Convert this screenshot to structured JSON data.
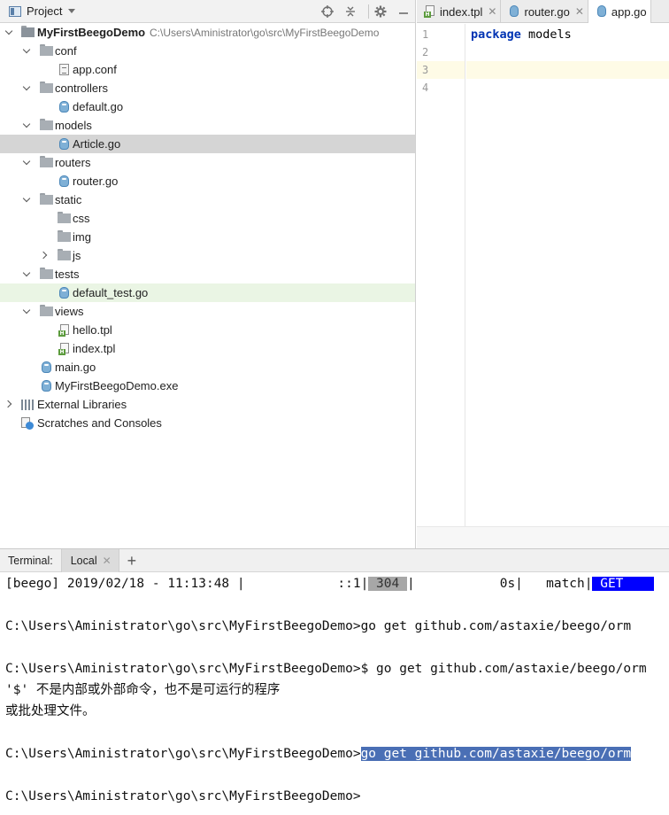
{
  "project": {
    "title": "Project",
    "tree": [
      {
        "id": "root",
        "label": "MyFirstBeegoDemo",
        "path": "C:\\Users\\Aministrator\\go\\src\\MyFirstBeegoDemo"
      },
      {
        "id": "conf",
        "label": "conf"
      },
      {
        "id": "app_conf",
        "label": "app.conf"
      },
      {
        "id": "controllers",
        "label": "controllers"
      },
      {
        "id": "default_go",
        "label": "default.go"
      },
      {
        "id": "models",
        "label": "models"
      },
      {
        "id": "article_go",
        "label": "Article.go"
      },
      {
        "id": "routers",
        "label": "routers"
      },
      {
        "id": "router_go",
        "label": "router.go"
      },
      {
        "id": "static",
        "label": "static"
      },
      {
        "id": "css",
        "label": "css"
      },
      {
        "id": "img",
        "label": "img"
      },
      {
        "id": "js",
        "label": "js"
      },
      {
        "id": "tests",
        "label": "tests"
      },
      {
        "id": "default_test_go",
        "label": "default_test.go"
      },
      {
        "id": "views",
        "label": "views"
      },
      {
        "id": "hello_tpl",
        "label": "hello.tpl"
      },
      {
        "id": "index_tpl",
        "label": "index.tpl"
      },
      {
        "id": "main_go",
        "label": "main.go"
      },
      {
        "id": "exe",
        "label": "MyFirstBeegoDemo.exe"
      },
      {
        "id": "ext_libs",
        "label": "External Libraries"
      },
      {
        "id": "scratches",
        "label": "Scratches and Consoles"
      }
    ]
  },
  "editor": {
    "tabs": [
      {
        "label": "index.tpl",
        "icon": "tpl-file-icon"
      },
      {
        "label": "router.go",
        "icon": "go-file-icon"
      },
      {
        "label": "app.go",
        "icon": "go-file-icon"
      }
    ],
    "line_numbers": [
      "1",
      "2",
      "3",
      "4"
    ],
    "code": {
      "line1_keyword": "package",
      "line1_rest": " models"
    }
  },
  "terminal": {
    "label": "Terminal:",
    "tab": "Local",
    "plus": "+",
    "status": {
      "prefix": "[beego] 2019/02/18 - 11:13:48 |            ::1|",
      "code": " 304 ",
      "middle": "|           0s|   match|",
      "method": " GET    "
    },
    "lines": [
      "C:\\Users\\Aministrator\\go\\src\\MyFirstBeegoDemo>go get github.com/astaxie/beego/orm",
      "C:\\Users\\Aministrator\\go\\src\\MyFirstBeegoDemo>$ go get github.com/astaxie/beego/orm",
      "'$' 不是内部或外部命令，也不是可运行的程序",
      "或批处理文件。",
      "C:\\Users\\Aministrator\\go\\src\\MyFirstBeegoDemo>",
      "go get github.com/astaxie/beego/orm",
      "C:\\Users\\Aministrator\\go\\src\\MyFirstBeegoDemo>"
    ]
  }
}
